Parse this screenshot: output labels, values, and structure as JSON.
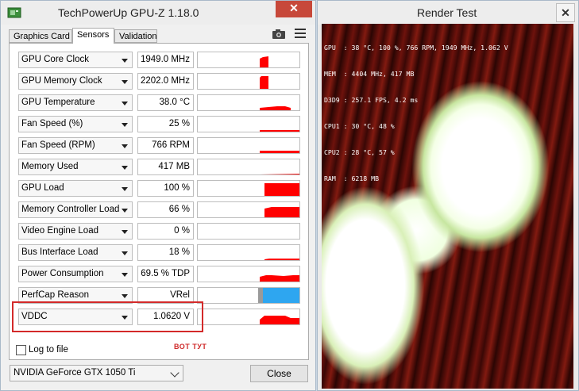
{
  "gpuz": {
    "title": "TechPowerUp GPU-Z 1.18.0",
    "close_symbol": "✕",
    "tabs": [
      {
        "label": "Graphics Card",
        "active": false
      },
      {
        "label": "Sensors",
        "active": true
      },
      {
        "label": "Validation",
        "active": false
      }
    ],
    "toolbar_icons": [
      "camera-icon",
      "hamburger-menu-icon"
    ],
    "sensors": [
      {
        "name": "GPU Core Clock",
        "value": "1949.0 MHz"
      },
      {
        "name": "GPU Memory Clock",
        "value": "2202.0 MHz"
      },
      {
        "name": "GPU Temperature",
        "value": "38.0 °C"
      },
      {
        "name": "Fan Speed (%)",
        "value": "25 %"
      },
      {
        "name": "Fan Speed (RPM)",
        "value": "766 RPM"
      },
      {
        "name": "Memory Used",
        "value": "417 MB"
      },
      {
        "name": "GPU Load",
        "value": "100 %"
      },
      {
        "name": "Memory Controller Load",
        "value": "66 %"
      },
      {
        "name": "Video Engine Load",
        "value": "0 %"
      },
      {
        "name": "Bus Interface Load",
        "value": "18 %"
      },
      {
        "name": "Power Consumption",
        "value": "69.5 % TDP"
      },
      {
        "name": "PerfCap Reason",
        "value": "VRel"
      },
      {
        "name": "VDDC",
        "value": "1.0620 V"
      }
    ],
    "annotation_note": "ВОТ ТУТ",
    "log_to_file": {
      "label": "Log to file",
      "checked": false
    },
    "gpu_select": {
      "value": "NVIDIA GeForce GTX 1050 Ti"
    },
    "close_button": "Close",
    "colors": {
      "graph": "#ff0000",
      "perfcap": "#2ea6f0",
      "highlight": "#d32a2a"
    }
  },
  "render_test": {
    "title": "Render Test",
    "close_symbol": "✕",
    "osd": [
      "GPU  : 38 °C, 100 %, 766 RPM, 1949 MHz, 1.062 V",
      "MEM  : 4404 MHz, 417 MB",
      "D3D9 : 257.1 FPS, 4.2 ms",
      "CPU1 : 30 °C, 48 %",
      "CPU2 : 28 °C, 57 %",
      "RAM  : 6218 MB"
    ]
  }
}
